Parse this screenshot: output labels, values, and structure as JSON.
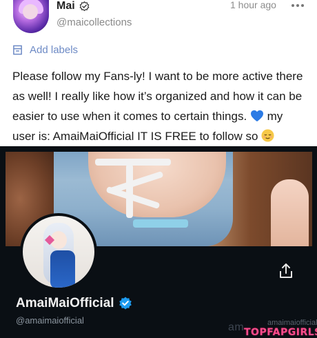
{
  "post": {
    "author_name": "Mai",
    "author_handle": "@maicollections",
    "timestamp": "1 hour ago",
    "labels_action": "Add labels",
    "text": "Please follow my Fans-ly! I want to be more active there as well! I really like how it’s organized and how it can be easier to use when it comes to certain things.",
    "text_after_heart": " my user is: AmaiMaiOfficial IT IS FREE to follow so ",
    "icons": [
      "verified-badge-icon",
      "more-options-icon",
      "label-icon",
      "blue-heart-emoji",
      "relieved-face-emoji"
    ]
  },
  "card": {
    "display_name": "AmaiMaiOfficial",
    "handle": "@amaimaiofficial",
    "watermark_text": "am",
    "watermark_small": "amaimaiofficial",
    "site_badge": "TOPFAPGIRLS",
    "icons": [
      "share-icon",
      "verified-badge-icon"
    ]
  },
  "colors": {
    "accent_blue": "#6d8ac5",
    "verified_blue": "#1d9bf0",
    "card_bg": "#0a0f14",
    "badge_pink": "#ff4d8d"
  }
}
